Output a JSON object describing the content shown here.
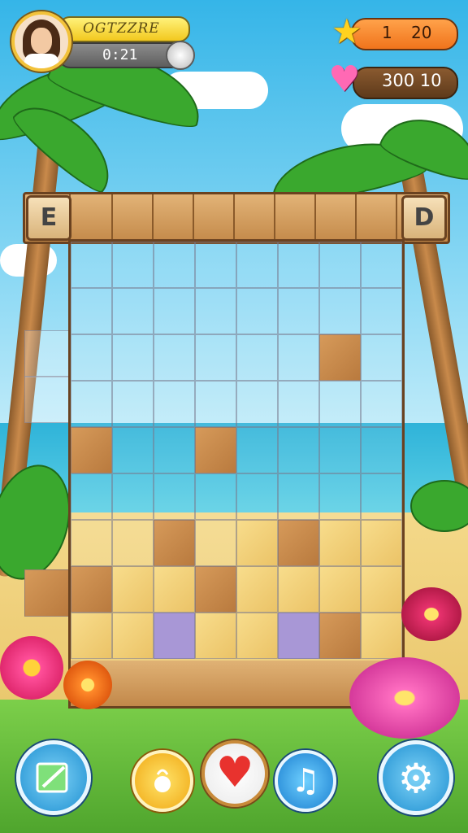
{
  "hud": {
    "player_name": "OGTZZRE",
    "timer": "0:21",
    "stars_left": "1",
    "stars_right": "20",
    "lives": "300 10"
  },
  "board": {
    "left_button_label": "E",
    "right_button_label": "D",
    "columns": 8,
    "rows": 9,
    "wood_cells": [
      [
        6,
        2
      ],
      [
        0,
        4
      ],
      [
        3,
        4
      ],
      [
        2,
        6
      ],
      [
        5,
        6
      ],
      [
        3,
        7
      ],
      [
        6,
        8
      ],
      [
        0,
        7
      ]
    ],
    "sand_cells": [
      [
        0,
        7
      ],
      [
        1,
        7
      ],
      [
        2,
        7
      ],
      [
        4,
        7
      ],
      [
        5,
        7
      ],
      [
        6,
        7
      ],
      [
        7,
        7
      ],
      [
        1,
        8
      ],
      [
        2,
        8
      ],
      [
        3,
        8
      ],
      [
        5,
        8
      ],
      [
        7,
        8
      ],
      [
        4,
        8
      ],
      [
        0,
        8
      ],
      [
        7,
        6
      ],
      [
        6,
        6
      ],
      [
        4,
        6
      ]
    ],
    "lavender_cells": [
      [
        2,
        8
      ],
      [
        5,
        8
      ]
    ]
  },
  "toolbar": {
    "edit_icon": "image-edit-icon",
    "hint_icon": "genie-lamp-icon",
    "lives_icon": "heart-icon",
    "music_icon": "music-note-icon",
    "settings_icon": "gear-icon"
  },
  "colors": {
    "accent_gold": "#f2c23a",
    "star_pill": "#f0741c",
    "heart": "#ff69b4",
    "wood": "#c48a4a"
  }
}
